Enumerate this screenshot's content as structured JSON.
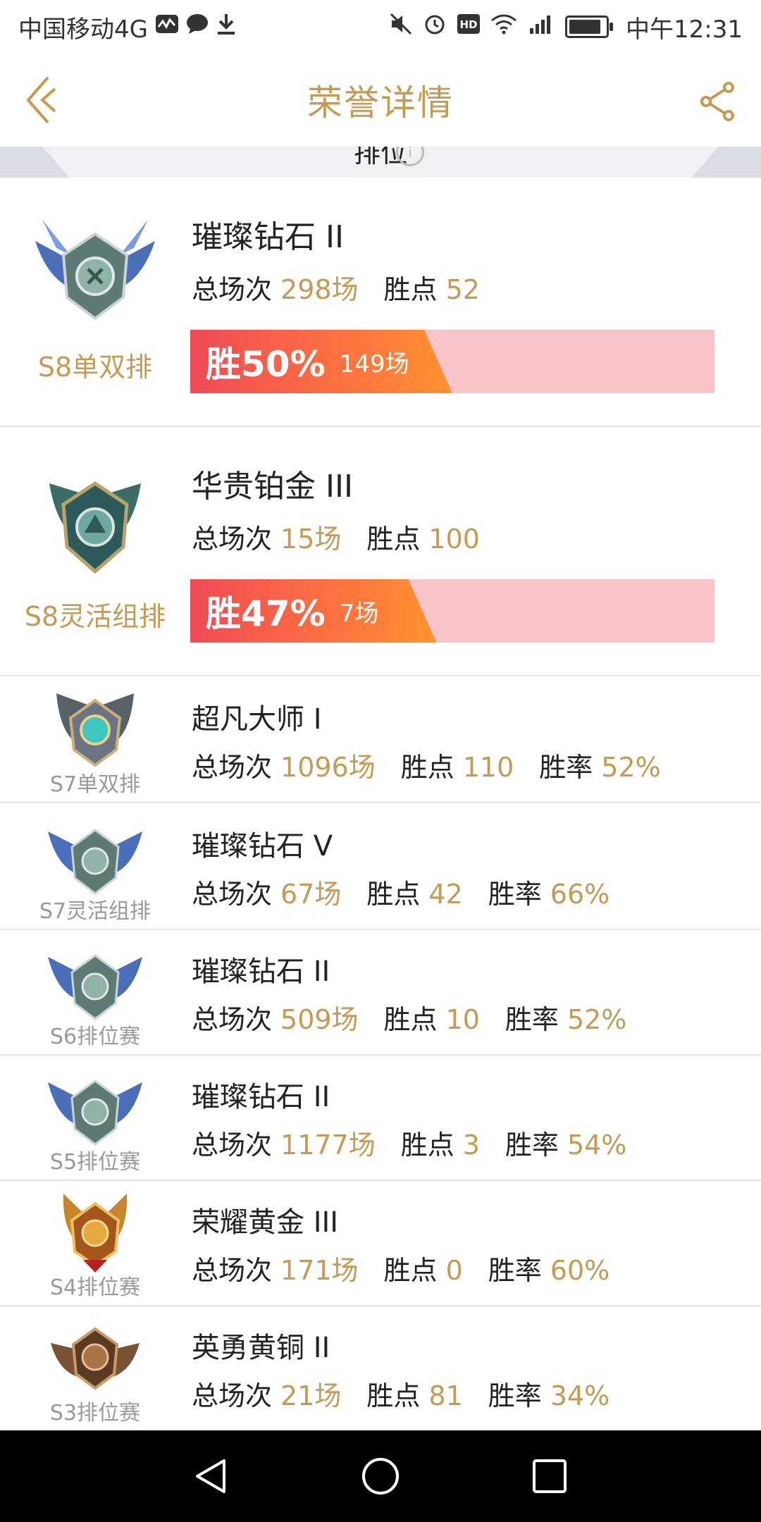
{
  "status_bar": {
    "carrier": "中国移动4G",
    "time": "中午12:31"
  },
  "header": {
    "title": "荣誉详情",
    "accent_color": "#c49a54"
  },
  "tab": {
    "label": "排位"
  },
  "labels": {
    "total_games": "总场次",
    "win_points": "胜点",
    "win_rate": "胜率"
  },
  "current_seasons": [
    {
      "season": "S8单双排",
      "rank": "璀璨钻石 II",
      "total_games": "298场",
      "win_points": "52",
      "win_rate_text": "胜50%",
      "wins_text": "149场",
      "win_rate_value": 0.5,
      "emblem": "diamond-emblem"
    },
    {
      "season": "S8灵活组排",
      "rank": "华贵铂金 III",
      "total_games": "15场",
      "win_points": "100",
      "win_rate_text": "胜47%",
      "wins_text": "7场",
      "win_rate_value": 0.47,
      "emblem": "platinum-emblem"
    }
  ],
  "history": [
    {
      "season": "S7单双排",
      "rank": "超凡大师 I",
      "total_games": "1096场",
      "win_points": "110",
      "win_rate": "52%",
      "emblem": "master-emblem"
    },
    {
      "season": "S7灵活组排",
      "rank": "璀璨钻石 V",
      "total_games": "67场",
      "win_points": "42",
      "win_rate": "66%",
      "emblem": "diamond-emblem"
    },
    {
      "season": "S6排位赛",
      "rank": "璀璨钻石 II",
      "total_games": "509场",
      "win_points": "10",
      "win_rate": "52%",
      "emblem": "diamond-emblem"
    },
    {
      "season": "S5排位赛",
      "rank": "璀璨钻石 II",
      "total_games": "1177场",
      "win_points": "3",
      "win_rate": "54%",
      "emblem": "diamond-emblem"
    },
    {
      "season": "S4排位赛",
      "rank": "荣耀黄金 III",
      "total_games": "171场",
      "win_points": "0",
      "win_rate": "60%",
      "emblem": "gold-emblem"
    },
    {
      "season": "S3排位赛",
      "rank": "英勇黄铜 II",
      "total_games": "21场",
      "win_points": "81",
      "win_rate": "34%",
      "emblem": "bronze-emblem"
    }
  ]
}
